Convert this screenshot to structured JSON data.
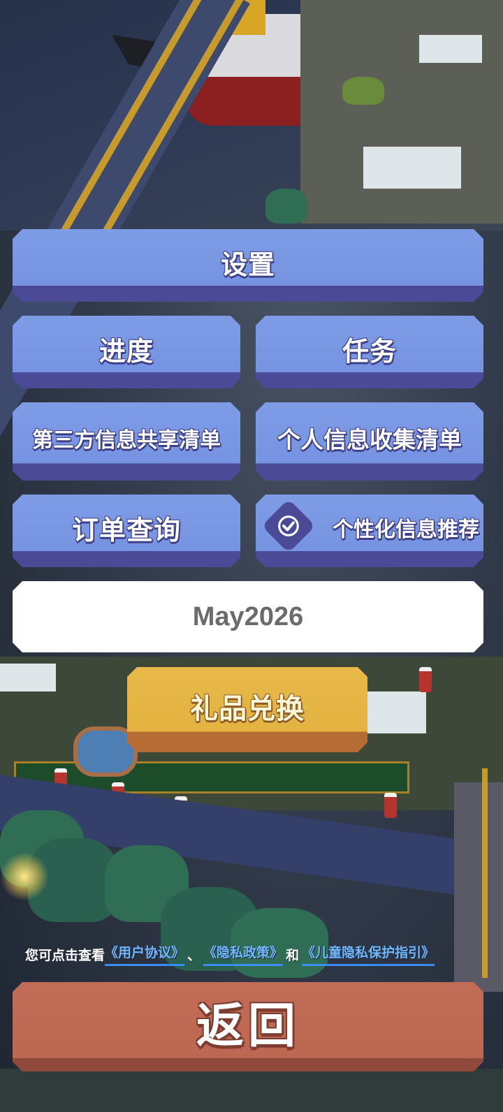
{
  "menu": {
    "settings_label": "设置",
    "progress_label": "进度",
    "tasks_label": "任务",
    "third_party_list_label": "第三方信息共享清单",
    "personal_info_list_label": "个人信息收集清单",
    "order_query_label": "订单查询",
    "personalized_recommend_label": "个性化信息推荐",
    "personalized_recommend_checked": true,
    "date_text": "May2026",
    "gift_exchange_label": "礼品兑换"
  },
  "footer": {
    "prefix": "您可点击查看",
    "user_agreement": "《用户协议》",
    "separator": "、",
    "privacy_policy": "《隐私政策》",
    "and_text": "和",
    "child_privacy": "《儿童隐私保护指引》",
    "back_label": "返回"
  },
  "colors": {
    "button_blue": "#7693e1",
    "button_blue_shadow": "#4a4a96",
    "button_yellow": "#e3b240",
    "button_red": "#bc6851",
    "link_blue": "#6fb6ff"
  },
  "icons": [
    "checkmark-icon"
  ]
}
